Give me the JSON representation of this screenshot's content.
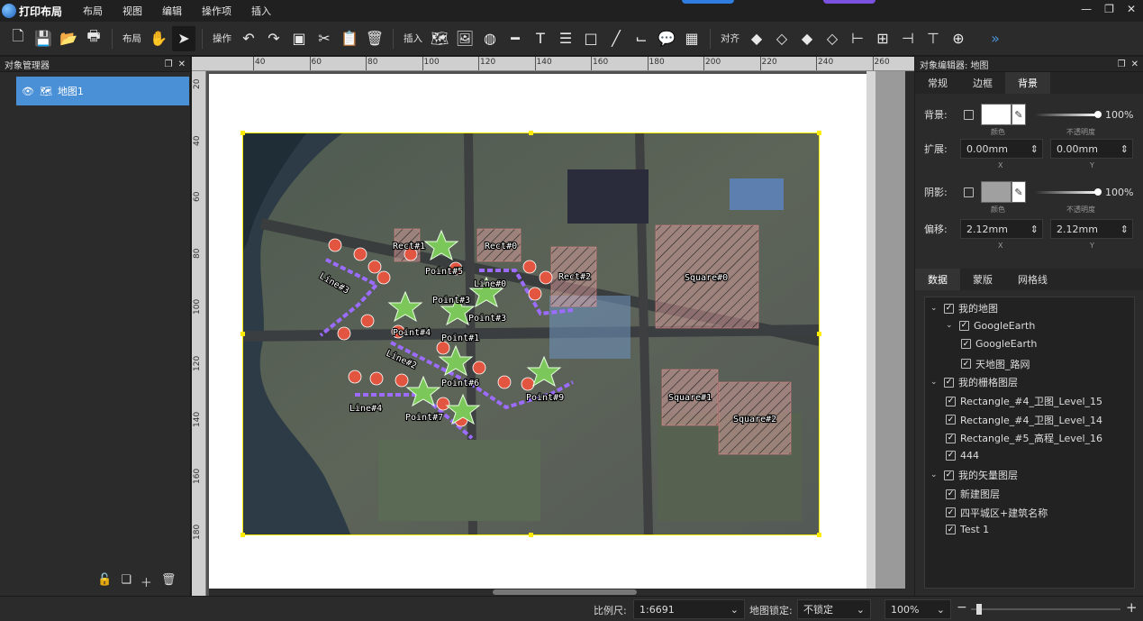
{
  "app": {
    "title": "打印布局"
  },
  "menu": [
    "布局",
    "视图",
    "编辑",
    "操作项",
    "插入"
  ],
  "toolbar": {
    "layout_label": "布局",
    "ops_label": "操作",
    "insert_label": "插入",
    "align_label": "对齐"
  },
  "object_manager": {
    "title": "对象管理器",
    "items": [
      {
        "label": "地图1"
      }
    ]
  },
  "ruler": {
    "h": [
      "40",
      "60",
      "80",
      "100",
      "120",
      "140",
      "160",
      "180",
      "200",
      "220",
      "240",
      "260"
    ],
    "v": [
      "20",
      "40",
      "60",
      "80",
      "100",
      "120",
      "140",
      "160",
      "180"
    ]
  },
  "map": {
    "labels": [
      "Rect#1",
      "Rect#0",
      "Rect#2",
      "Square#0",
      "Point#5",
      "Line#0",
      "Line#3",
      "Point#3",
      "Point#4",
      "Point#1",
      "Point#3",
      "Line#2",
      "Point#6",
      "Point#9",
      "Square#1",
      "Square#2",
      "Line#4",
      "Point#7"
    ]
  },
  "editor": {
    "title": "对象编辑器: 地图",
    "tabs": [
      "常规",
      "边框",
      "背景"
    ],
    "bg_label": "背景:",
    "color_sub": "颜色",
    "opacity_sub": "不透明度",
    "bg_opacity": "100%",
    "extend_label": "扩展:",
    "extend_x": "0.00mm",
    "extend_y": "0.00mm",
    "x_sub": "X",
    "y_sub": "Y",
    "shadow_label": "阴影:",
    "shadow_opacity": "100%",
    "offset_label": "偏移:",
    "offset_x": "2.12mm",
    "offset_y": "2.12mm"
  },
  "data_panel": {
    "tabs": [
      "数据",
      "蒙版",
      "网格线"
    ],
    "tree": [
      {
        "label": "我的地图",
        "level": 0,
        "expand": true
      },
      {
        "label": "GoogleEarth",
        "level": 1,
        "expand": true
      },
      {
        "label": "GoogleEarth",
        "level": 2,
        "expand": false
      },
      {
        "label": "天地图_路网",
        "level": 2,
        "expand": false
      },
      {
        "label": "我的栅格图层",
        "level": 0,
        "expand": true
      },
      {
        "label": "Rectangle_#4_卫图_Level_15",
        "level": 1,
        "expand": false
      },
      {
        "label": "Rectangle_#4_卫图_Level_14",
        "level": 1,
        "expand": false
      },
      {
        "label": "Rectangle_#5_高程_Level_16",
        "level": 1,
        "expand": false
      },
      {
        "label": "444",
        "level": 1,
        "expand": false
      },
      {
        "label": "我的矢量图层",
        "level": 0,
        "expand": true
      },
      {
        "label": "新建图层",
        "level": 1,
        "expand": false
      },
      {
        "label": "四平城区+建筑名称",
        "level": 1,
        "expand": false
      },
      {
        "label": "Test 1",
        "level": 1,
        "expand": false
      }
    ]
  },
  "status": {
    "scale_label": "比例尺:",
    "scale_value": "1:6691",
    "lock_label": "地图锁定:",
    "lock_value": "不锁定",
    "zoom": "100%"
  },
  "colors": {
    "accent": "#4a90d6",
    "selection": "#ffec00",
    "hatch": "#e8a0a0",
    "line": "#9b6cff"
  }
}
